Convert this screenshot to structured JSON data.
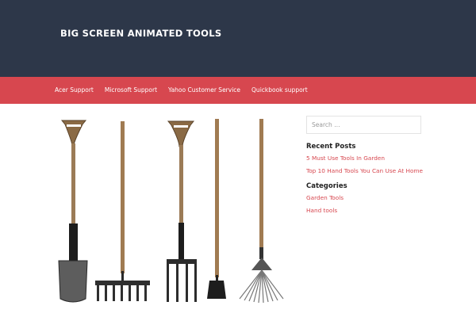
{
  "site": {
    "title": "BIG SCREEN ANIMATED TOOLS"
  },
  "colors": {
    "header_bg": "#2d3749",
    "nav_bg": "#d7474f",
    "link": "#d7474f"
  },
  "nav": {
    "items": [
      {
        "label": "Acer Support"
      },
      {
        "label": "Microsoft Support"
      },
      {
        "label": "Yahoo Customer Service"
      },
      {
        "label": "Quickbook support"
      }
    ]
  },
  "main": {
    "image_icon": "garden-tools-image"
  },
  "sidebar": {
    "search": {
      "placeholder": "Search …"
    },
    "recent_posts": {
      "title": "Recent Posts",
      "items": [
        {
          "label": "5 Must Use Tools In Garden"
        },
        {
          "label": "Top 10 Hand Tools You Can Use At Home"
        }
      ]
    },
    "categories": {
      "title": "Categories",
      "items": [
        {
          "label": "Garden Tools"
        },
        {
          "label": "Hand tools"
        }
      ]
    }
  }
}
